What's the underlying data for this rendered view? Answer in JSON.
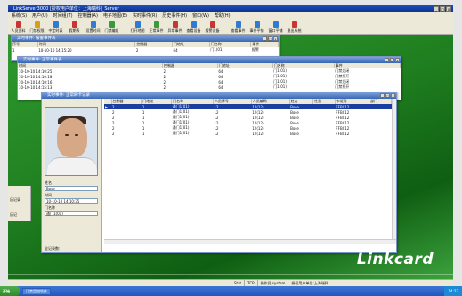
{
  "app": {
    "title": "LinkServer3000 [授权用户单位：上海瑞科]_Server"
  },
  "menu": [
    "系统(S)",
    "用户(U)",
    "时间组(T)",
    "控制器(A)",
    "电子地图(E)",
    "实时事件(R)",
    "历史事件(H)",
    "窗口(W)",
    "帮助(H)"
  ],
  "toolbar": [
    {
      "label": "人员资料",
      "icon": "person-icon",
      "color": "#c33"
    },
    {
      "label": "门禁权限",
      "icon": "key-icon",
      "color": "#d4a017"
    },
    {
      "label": "中定时表",
      "icon": "clock-icon",
      "color": "#2f7bd1"
    },
    {
      "label": "假期表",
      "icon": "calendar-icon",
      "color": "#c33"
    },
    {
      "label": "设置时间",
      "icon": "time-icon",
      "color": "#2f7bd1"
    },
    {
      "label": "门禁编组",
      "icon": "group-icon",
      "color": "#3a9a3a"
    },
    {
      "label": "打开地图",
      "icon": "map-icon",
      "color": "#2f7bd1"
    },
    {
      "label": "正常事件",
      "icon": "event-icon",
      "color": "#3a9a3a"
    },
    {
      "label": "异常事件",
      "icon": "warning-icon",
      "color": "#c33"
    },
    {
      "label": "查看设备",
      "icon": "device-icon",
      "color": "#2f7bd1"
    },
    {
      "label": "报警设备",
      "icon": "alarm-icon",
      "color": "#c33"
    },
    {
      "label": "查看事件",
      "icon": "list-icon",
      "color": "#2f7bd1"
    },
    {
      "label": "事件平铺",
      "icon": "tile-icon",
      "color": "#2f7bd1"
    },
    {
      "label": "窗口平铺",
      "icon": "window-icon",
      "color": "#2f7bd1"
    },
    {
      "label": "退出系统",
      "icon": "exit-icon",
      "color": "#c33"
    }
  ],
  "win_alarm": {
    "title": "实时事件: 报警事件表",
    "cols": [
      "序号",
      "时间",
      "控制器",
      "门地址",
      "门名称",
      "事件"
    ],
    "row": [
      "1",
      "10-10-10 14:15:20",
      "2",
      "64",
      "门1(01)",
      "报警"
    ]
  },
  "win_normal": {
    "title": "实时事件: 正常事件表",
    "cols": [
      "时间",
      "控制器",
      "门地址",
      "门名称",
      "事件"
    ],
    "rows": [
      [
        "10-10-10 14:10:25",
        "2",
        "64",
        "门1(01)",
        "门禁关闭"
      ],
      [
        "10-10-10 14:10:18",
        "2",
        "64",
        "门1(01)",
        "门禁打开"
      ],
      [
        "10-10-10 14:10:16",
        "2",
        "64",
        "门1(01)",
        "门禁关闭"
      ],
      [
        "10-10-10 14:15:13",
        "2",
        "64",
        "门1(01)",
        "门禁打开"
      ]
    ]
  },
  "win_card": {
    "title": "实时事件: 正常刷卡记录",
    "cols": [
      "控制器",
      "门地址",
      "门名称",
      "人员序号",
      "人员编码",
      "姓名",
      "性别",
      "卡证号",
      "部门"
    ],
    "rows": [
      [
        "2",
        "1",
        "通门1(01)",
        "12",
        "12(12)",
        "Bose",
        "",
        "FFB012",
        ""
      ],
      [
        "2",
        "1",
        "通门1(01)",
        "12",
        "12(12)",
        "Bose",
        "",
        "FFB012",
        ""
      ],
      [
        "2",
        "1",
        "通门1(01)",
        "12",
        "12(12)",
        "Bose",
        "",
        "FFB012",
        ""
      ],
      [
        "2",
        "1",
        "通门1(01)",
        "12",
        "12(12)",
        "Bose",
        "",
        "FFB012",
        ""
      ],
      [
        "2",
        "1",
        "通门1(01)",
        "12",
        "12(12)",
        "Bose",
        "",
        "FFB012",
        ""
      ],
      [
        "2",
        "1",
        "通门1(01)",
        "12",
        "12(12)",
        "Bose",
        "",
        "FFB012",
        ""
      ]
    ],
    "name_label": "姓名",
    "name_value": "Bose",
    "time_label": "时间",
    "time_value": "10-10-10 14:10:35",
    "door_label": "门名称",
    "door_value": "通门1(01)",
    "footer_label": "全记录数:"
  },
  "side": {
    "label1": "历记录",
    "label2": "历记"
  },
  "logo": "Linkcard",
  "status": [
    "Stat",
    "TCP",
    "操作员:system",
    "授权用户单位:上海瑞科"
  ],
  "taskbar": {
    "start": "开始",
    "items": [
      "门禁监控软件"
    ],
    "clock": "14:22"
  },
  "colors": {
    "title_bar": "#0a2f8f",
    "desktop_green": "#1f7e1f",
    "selection": "#1a3fa0"
  }
}
